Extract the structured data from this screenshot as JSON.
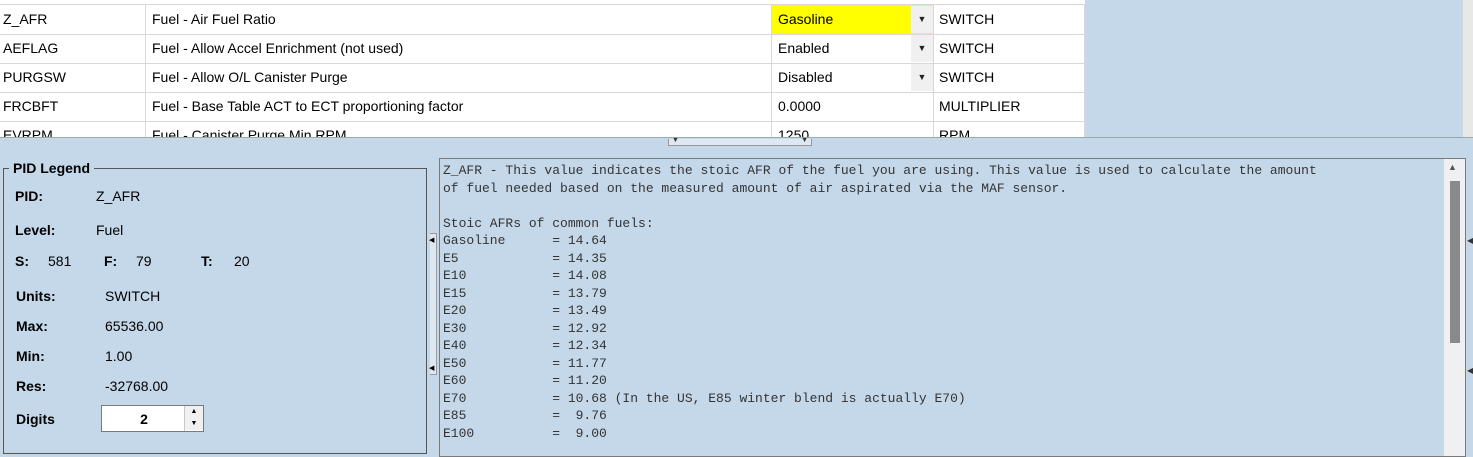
{
  "grid": {
    "rows": [
      {
        "pid": "Z_AFR",
        "desc": "Fuel - Air Fuel Ratio",
        "value": "Gasoline",
        "unit": "SWITCH",
        "dropdown": true,
        "selected": true
      },
      {
        "pid": "AEFLAG",
        "desc": "Fuel - Allow Accel Enrichment (not used)",
        "value": "Enabled",
        "unit": "SWITCH",
        "dropdown": true,
        "selected": false
      },
      {
        "pid": "PURGSW",
        "desc": "Fuel - Allow O/L Canister Purge",
        "value": "Disabled",
        "unit": "SWITCH",
        "dropdown": true,
        "selected": false
      },
      {
        "pid": "FRCBFT",
        "desc": "Fuel - Base Table ACT to ECT proportioning factor",
        "value": "0.0000",
        "unit": "MULTIPLIER",
        "dropdown": false,
        "selected": false
      },
      {
        "pid": "EVRPM",
        "desc": "Fuel - Canister Purge Min RPM",
        "value": "1250",
        "unit": "RPM",
        "dropdown": false,
        "selected": false
      }
    ],
    "selected_color": "#ffff00"
  },
  "legend": {
    "title": "PID Legend",
    "pid_label": "PID:",
    "pid_value": "Z_AFR",
    "level_label": "Level:",
    "level_value": "Fuel",
    "s_label": "S:",
    "s_value": "581",
    "f_label": "F:",
    "f_value": "79",
    "t_label": "T:",
    "t_value": "20",
    "units_label": "Units:",
    "units_value": "SWITCH",
    "max_label": "Max:",
    "max_value": "65536.00",
    "min_label": "Min:",
    "min_value": "1.00",
    "res_label": "Res:",
    "res_value": "-32768.00",
    "digits_label": "Digits",
    "digits_value": "2"
  },
  "description": {
    "text": "Z_AFR - This value indicates the stoic AFR of the fuel you are using. This value is used to calculate the amount\nof fuel needed based on the measured amount of air aspirated via the MAF sensor.\n\nStoic AFRs of common fuels:\nGasoline      = 14.64\nE5            = 14.35\nE10           = 14.08\nE15           = 13.79\nE20           = 13.49\nE30           = 12.92\nE40           = 12.34\nE50           = 11.77\nE60           = 11.20\nE70           = 10.68 (In the US, E85 winter blend is actually E70)\nE85           =  9.76\nE100          =  9.00"
  },
  "icons": {
    "dropdown": "chevron-down-icon",
    "spin_up": "spin-up-icon",
    "spin_down": "spin-down-icon"
  },
  "colors": {
    "background": "#c5d8ea",
    "grid_bg": "#ffffff",
    "scroll_thumb": "#8a8a8a"
  }
}
